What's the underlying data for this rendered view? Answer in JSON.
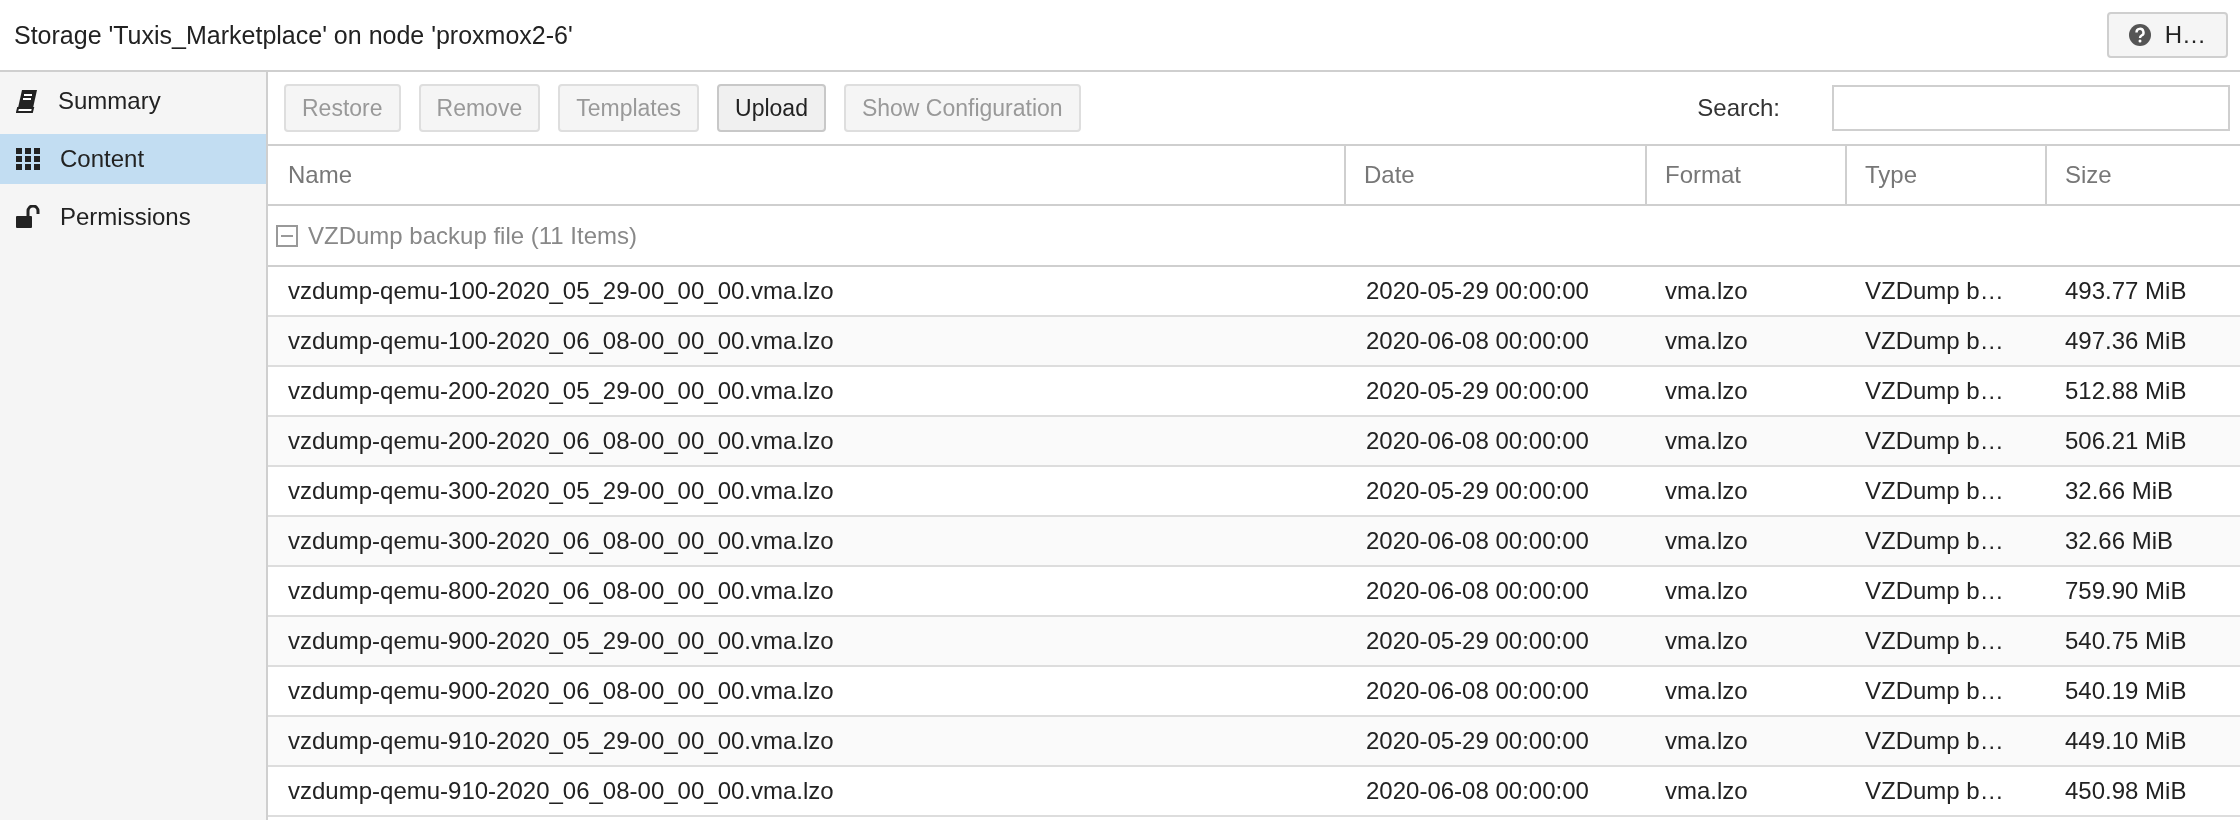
{
  "window": {
    "title": "Storage 'Tuxis_Marketplace' on node 'proxmox2-6'",
    "help_button": "H…"
  },
  "sidebar": {
    "items": [
      {
        "label": "Summary",
        "selected": false
      },
      {
        "label": "Content",
        "selected": true
      },
      {
        "label": "Permissions",
        "selected": false
      }
    ]
  },
  "toolbar": {
    "buttons": [
      {
        "label": "Restore",
        "disabled": true
      },
      {
        "label": "Remove",
        "disabled": true
      },
      {
        "label": "Templates",
        "disabled": true
      },
      {
        "label": "Upload",
        "disabled": false
      },
      {
        "label": "Show Configuration",
        "disabled": true
      }
    ],
    "search": {
      "label": "Search:"
    }
  },
  "table": {
    "columns": [
      "Name",
      "Date",
      "Format",
      "Type",
      "Size"
    ],
    "group": {
      "label": "VZDump backup file (11 Items)",
      "expanded": true
    },
    "rows": [
      [
        "vzdump-qemu-100-2020_05_29-00_00_00.vma.lzo",
        "2020-05-29 00:00:00",
        "vma.lzo",
        "VZDump b…",
        "493.77 MiB"
      ],
      [
        "vzdump-qemu-100-2020_06_08-00_00_00.vma.lzo",
        "2020-06-08 00:00:00",
        "vma.lzo",
        "VZDump b…",
        "497.36 MiB"
      ],
      [
        "vzdump-qemu-200-2020_05_29-00_00_00.vma.lzo",
        "2020-05-29 00:00:00",
        "vma.lzo",
        "VZDump b…",
        "512.88 MiB"
      ],
      [
        "vzdump-qemu-200-2020_06_08-00_00_00.vma.lzo",
        "2020-06-08 00:00:00",
        "vma.lzo",
        "VZDump b…",
        "506.21 MiB"
      ],
      [
        "vzdump-qemu-300-2020_05_29-00_00_00.vma.lzo",
        "2020-05-29 00:00:00",
        "vma.lzo",
        "VZDump b…",
        "32.66 MiB"
      ],
      [
        "vzdump-qemu-300-2020_06_08-00_00_00.vma.lzo",
        "2020-06-08 00:00:00",
        "vma.lzo",
        "VZDump b…",
        "32.66 MiB"
      ],
      [
        "vzdump-qemu-800-2020_06_08-00_00_00.vma.lzo",
        "2020-06-08 00:00:00",
        "vma.lzo",
        "VZDump b…",
        "759.90 MiB"
      ],
      [
        "vzdump-qemu-900-2020_05_29-00_00_00.vma.lzo",
        "2020-05-29 00:00:00",
        "vma.lzo",
        "VZDump b…",
        "540.75 MiB"
      ],
      [
        "vzdump-qemu-900-2020_06_08-00_00_00.vma.lzo",
        "2020-06-08 00:00:00",
        "vma.lzo",
        "VZDump b…",
        "540.19 MiB"
      ],
      [
        "vzdump-qemu-910-2020_05_29-00_00_00.vma.lzo",
        "2020-05-29 00:00:00",
        "vma.lzo",
        "VZDump b…",
        "449.10 MiB"
      ],
      [
        "vzdump-qemu-910-2020_06_08-00_00_00.vma.lzo",
        "2020-06-08 00:00:00",
        "vma.lzo",
        "VZDump b…",
        "450.98 MiB"
      ]
    ]
  }
}
